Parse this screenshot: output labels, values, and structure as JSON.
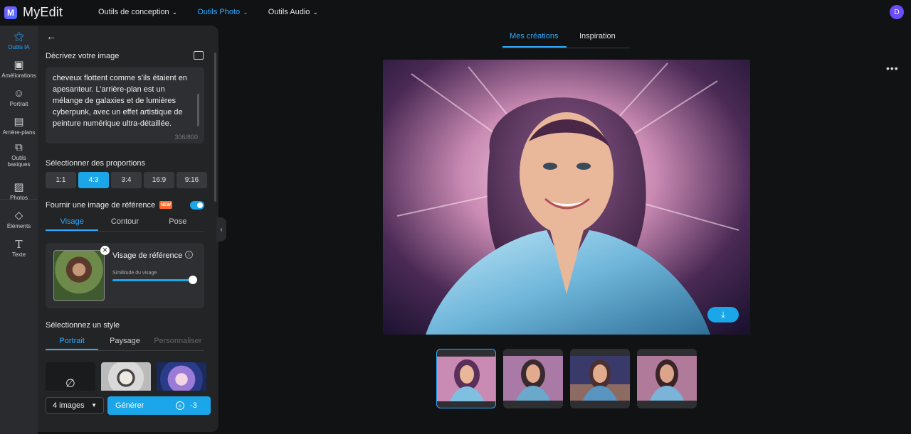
{
  "app": {
    "name": "MyEdit",
    "logo_letter": "M"
  },
  "topnav": [
    {
      "label": "Outils de conception",
      "active": false
    },
    {
      "label": "Outils Photo",
      "active": true
    },
    {
      "label": "Outils Audio",
      "active": false
    }
  ],
  "user": {
    "initial": "D"
  },
  "rail": {
    "items": [
      {
        "label": "Outils IA",
        "icon": "magic-wand-icon"
      },
      {
        "label": "Améliorations",
        "icon": "image-enhance-icon"
      },
      {
        "label": "Portrait",
        "icon": "portrait-icon"
      },
      {
        "label": "Arrière-plans",
        "icon": "background-icon"
      },
      {
        "label": "Outils basiques",
        "icon": "crop-icon"
      },
      {
        "label": "Photos",
        "icon": "photo-icon"
      },
      {
        "label": "Éléments",
        "icon": "shapes-icon"
      },
      {
        "label": "Texte",
        "icon": "text-icon"
      }
    ]
  },
  "panel": {
    "describe_title": "Décrivez votre image",
    "prompt_text": "cheveux flottent comme s’ils étaient en apesanteur. L’arrière-plan est un mélange de galaxies et de lumières cyberpunk, avec un effet artistique de peinture numérique ultra-détaillée.",
    "prompt_count": "306/800",
    "ratio_title": "Sélectionner des proportions",
    "ratios": [
      "1:1",
      "4:3",
      "3:4",
      "16:9",
      "9:16"
    ],
    "ratio_selected": "4:3",
    "reference_title": "Fournir une image de référence",
    "new_badge": "NEW",
    "reference_tabs": [
      "Visage",
      "Contour",
      "Pose"
    ],
    "reference_card": {
      "title": "Visage de référence",
      "info": "i",
      "similarity_label": "Similitude du visage",
      "similarity_value": 0.96
    },
    "style_title": "Sélectionnez un style",
    "style_tabs": [
      "Portrait",
      "Paysage",
      "Personnaliser"
    ],
    "image_count": "4 images",
    "generate_label": "Générer",
    "credit_cost": "-3"
  },
  "main": {
    "tabs": [
      "Mes créations",
      "Inspiration"
    ],
    "more": "•••"
  }
}
